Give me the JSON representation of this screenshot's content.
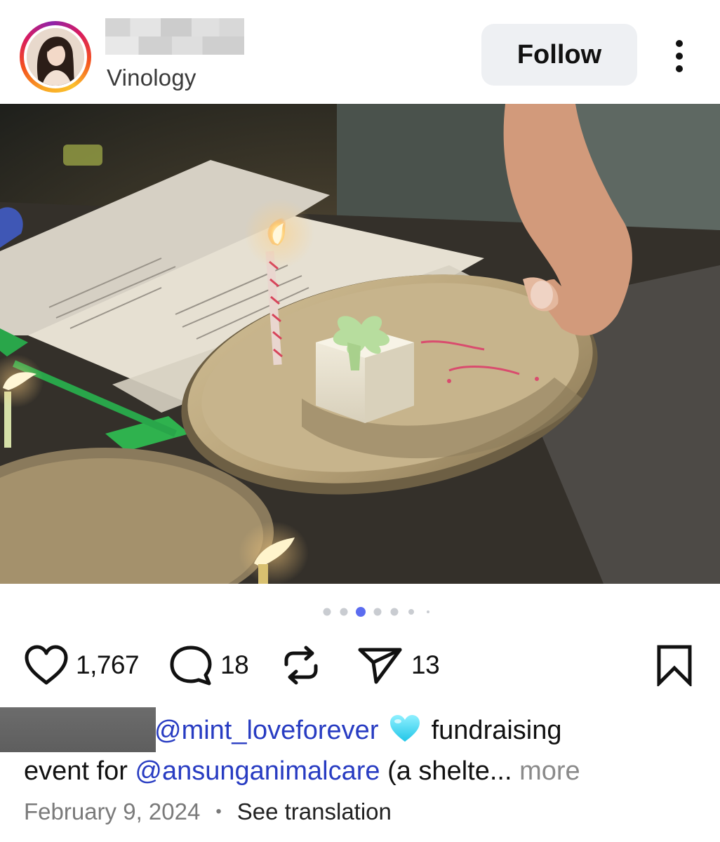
{
  "header": {
    "username": "",
    "subtitle": "Vinology",
    "follow_label": "Follow",
    "avatar_icon": "profile-photo-icon",
    "menu_icon": "more-vertical-icon"
  },
  "carousel": {
    "total_dots": 7,
    "active_index": 2,
    "active_color": "#5b6cf0",
    "inactive_color": "#c9ccd1"
  },
  "actions": {
    "like_icon": "heart-icon",
    "likes": "1,767",
    "comment_icon": "comment-icon",
    "comments": "18",
    "repost_icon": "repost-icon",
    "share_icon": "send-icon",
    "shares": "13",
    "save_icon": "bookmark-icon"
  },
  "caption": {
    "mention1": "@mint_loveforever",
    "emoji": "light-blue-heart",
    "text1": " fundraising",
    "text2": "event for ",
    "mention2": "@ansunganimalcare",
    "text3": " (a shelte...",
    "more_label": " more"
  },
  "meta": {
    "date": "February 9, 2024",
    "separator": "•",
    "translate_label": "See translation"
  },
  "colors": {
    "mention": "#283cc2",
    "follow_bg": "#eef0f3",
    "muted": "#7a7a7a"
  }
}
